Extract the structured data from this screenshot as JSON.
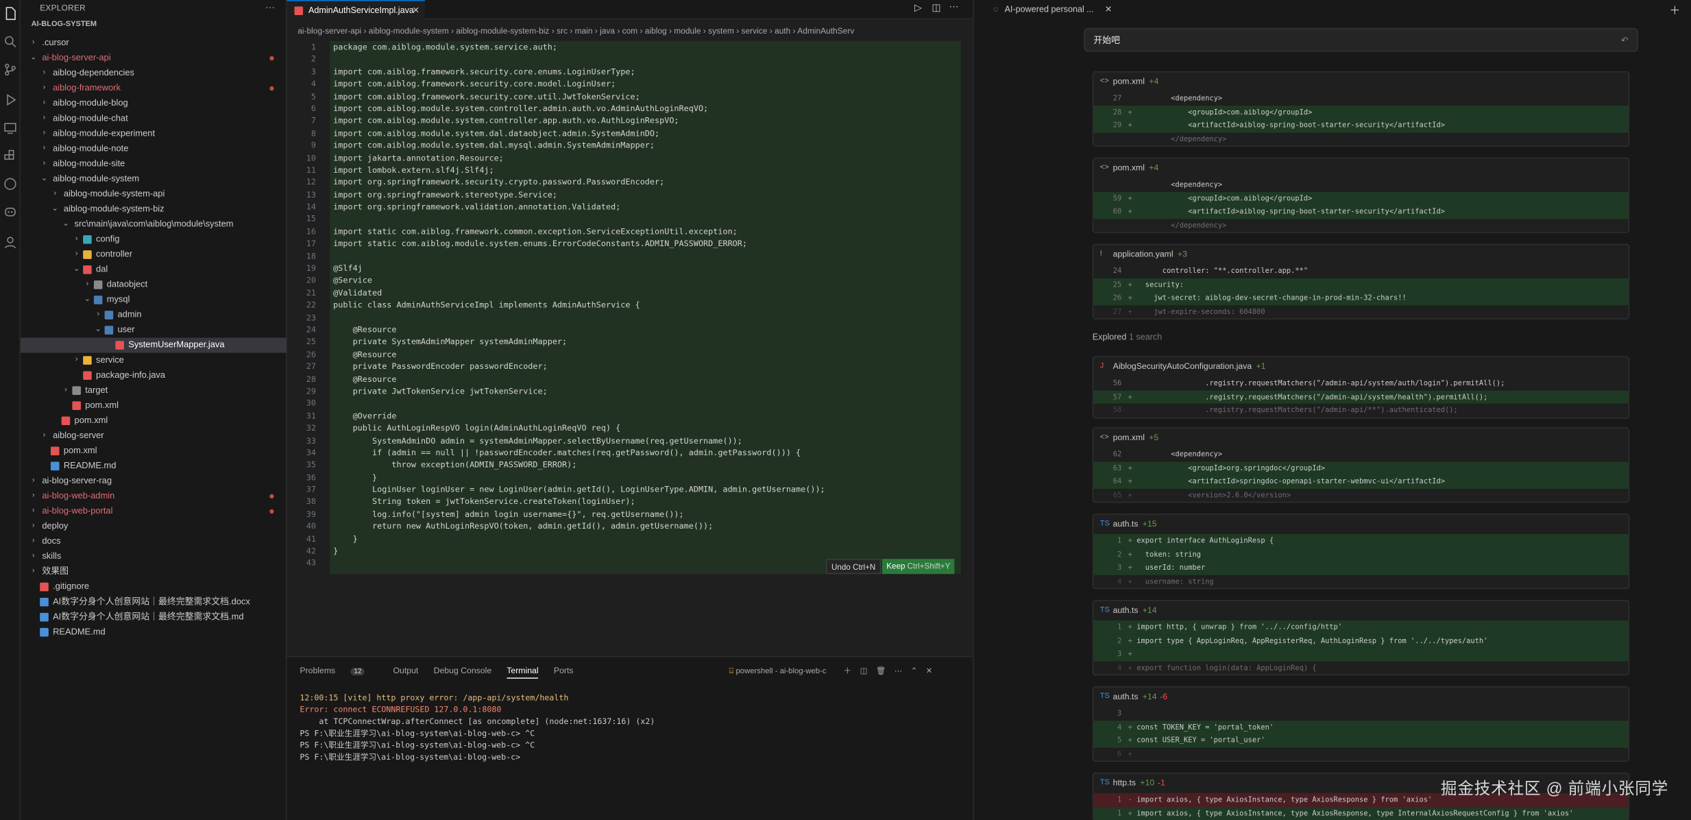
{
  "explorer": {
    "title": "EXPLORER",
    "root": "AI-BLOG-SYSTEM",
    "items": [
      {
        "label": ".cursor",
        "depth": 1,
        "type": "folder",
        "open": false,
        "color": "#ccc"
      },
      {
        "label": "ai-blog-server-api",
        "depth": 1,
        "type": "folder",
        "open": true,
        "color": "#e06c75",
        "dot": true
      },
      {
        "label": "aiblog-dependencies",
        "depth": 2,
        "type": "folder",
        "open": false,
        "color": "#ccc"
      },
      {
        "label": "aiblog-framework",
        "depth": 2,
        "type": "folder",
        "open": false,
        "color": "#e06c75",
        "dot": true
      },
      {
        "label": "aiblog-module-blog",
        "depth": 2,
        "type": "folder",
        "open": false,
        "color": "#ccc"
      },
      {
        "label": "aiblog-module-chat",
        "depth": 2,
        "type": "folder",
        "open": false,
        "color": "#ccc"
      },
      {
        "label": "aiblog-module-experiment",
        "depth": 2,
        "type": "folder",
        "open": false,
        "color": "#ccc"
      },
      {
        "label": "aiblog-module-note",
        "depth": 2,
        "type": "folder",
        "open": false,
        "color": "#ccc"
      },
      {
        "label": "aiblog-module-site",
        "depth": 2,
        "type": "folder",
        "open": false,
        "color": "#ccc"
      },
      {
        "label": "aiblog-module-system",
        "depth": 2,
        "type": "folder",
        "open": true,
        "color": "#ccc"
      },
      {
        "label": "aiblog-module-system-api",
        "depth": 3,
        "type": "folder",
        "open": false,
        "color": "#ccc"
      },
      {
        "label": "aiblog-module-system-biz",
        "depth": 3,
        "type": "folder",
        "open": true,
        "color": "#ccc"
      },
      {
        "label": "src\\main\\java\\com\\aiblog\\module\\system",
        "depth": 4,
        "type": "folder",
        "open": true,
        "color": "#ccc"
      },
      {
        "label": "config",
        "depth": 5,
        "type": "folder",
        "open": false,
        "color": "#ccc",
        "ficon": "#3aa6b9"
      },
      {
        "label": "controller",
        "depth": 5,
        "type": "folder",
        "open": false,
        "color": "#ccc",
        "ficon": "#e8b339"
      },
      {
        "label": "dal",
        "depth": 5,
        "type": "folder",
        "open": true,
        "color": "#ccc",
        "ficon": "#e55353"
      },
      {
        "label": "dataobject",
        "depth": 6,
        "type": "folder",
        "open": false,
        "color": "#ccc",
        "ficon": "#8a8a8a"
      },
      {
        "label": "mysql",
        "depth": 6,
        "type": "folder",
        "open": true,
        "color": "#ccc",
        "ficon": "#4a7fb5"
      },
      {
        "label": "admin",
        "depth": 7,
        "type": "folder",
        "open": false,
        "color": "#ccc",
        "ficon": "#4a7fb5"
      },
      {
        "label": "user",
        "depth": 7,
        "type": "folder",
        "open": true,
        "color": "#ccc",
        "ficon": "#4a7fb5"
      },
      {
        "label": "SystemUserMapper.java",
        "depth": 8,
        "type": "file",
        "color": "#fff",
        "ficon": "#e55353",
        "selected": true
      },
      {
        "label": "service",
        "depth": 5,
        "type": "folder",
        "open": false,
        "color": "#ccc",
        "ficon": "#e8b339"
      },
      {
        "label": "package-info.java",
        "depth": 5,
        "type": "file",
        "color": "#ccc",
        "ficon": "#e55353"
      },
      {
        "label": "target",
        "depth": 4,
        "type": "folder",
        "open": false,
        "color": "#ccc",
        "ficon": "#8a8a8a"
      },
      {
        "label": "pom.xml",
        "depth": 4,
        "type": "file",
        "color": "#ccc",
        "ficon": "#e55353"
      },
      {
        "label": "pom.xml",
        "depth": 3,
        "type": "file",
        "color": "#ccc",
        "ficon": "#e55353"
      },
      {
        "label": "aiblog-server",
        "depth": 2,
        "type": "folder",
        "open": false,
        "color": "#ccc"
      },
      {
        "label": "pom.xml",
        "depth": 2,
        "type": "file",
        "color": "#ccc",
        "ficon": "#e55353"
      },
      {
        "label": "README.md",
        "depth": 2,
        "type": "file",
        "color": "#ccc",
        "ficon": "#4a90d9"
      },
      {
        "label": "ai-blog-server-rag",
        "depth": 1,
        "type": "folder",
        "open": false,
        "color": "#ccc"
      },
      {
        "label": "ai-blog-web-admin",
        "depth": 1,
        "type": "folder",
        "open": false,
        "color": "#e06c75",
        "dot": true
      },
      {
        "label": "ai-blog-web-portal",
        "depth": 1,
        "type": "folder",
        "open": false,
        "color": "#e06c75",
        "dot": true
      },
      {
        "label": "deploy",
        "depth": 1,
        "type": "folder",
        "open": false,
        "color": "#ccc"
      },
      {
        "label": "docs",
        "depth": 1,
        "type": "folder",
        "open": false,
        "color": "#ccc"
      },
      {
        "label": "skills",
        "depth": 1,
        "type": "folder",
        "open": false,
        "color": "#ccc"
      },
      {
        "label": "效果图",
        "depth": 1,
        "type": "folder",
        "open": false,
        "color": "#ccc"
      },
      {
        "label": ".gitignore",
        "depth": 1,
        "type": "file",
        "color": "#ccc",
        "ficon": "#e55353"
      },
      {
        "label": "AI数字分身个人创意网站｜最终完整需求文档.docx",
        "depth": 1,
        "type": "file",
        "color": "#ccc",
        "ficon": "#4a90d9"
      },
      {
        "label": "AI数字分身个人创意网站｜最终完整需求文档.md",
        "depth": 1,
        "type": "file",
        "color": "#ccc",
        "ficon": "#4a90d9"
      },
      {
        "label": "README.md",
        "depth": 1,
        "type": "file",
        "color": "#ccc",
        "ficon": "#4a90d9"
      }
    ]
  },
  "editor": {
    "tab": "AdminAuthServiceImpl.java",
    "breadcrumb": "ai-blog-server-api  ›  aiblog-module-system  ›  aiblog-module-system-biz  ›  src  ›  main  ›  java  ›  com  ›  aiblog  ›  module  ›  system  ›  service  ›  auth  ›  AdminAuthServ",
    "undo": "Undo Ctrl+N",
    "keep": "Keep",
    "keep_shortcut": "Ctrl+Shift+Y",
    "lines": [
      {
        "n": "1",
        "t": "package com.aiblog.module.system.service.auth;"
      },
      {
        "n": "2",
        "t": ""
      },
      {
        "n": "3",
        "t": "import com.aiblog.framework.security.core.enums.LoginUserType;"
      },
      {
        "n": "4",
        "t": "import com.aiblog.framework.security.core.model.LoginUser;"
      },
      {
        "n": "5",
        "t": "import com.aiblog.framework.security.core.util.JwtTokenService;"
      },
      {
        "n": "6",
        "t": "import com.aiblog.module.system.controller.admin.auth.vo.AdminAuthLoginReqVO;"
      },
      {
        "n": "7",
        "t": "import com.aiblog.module.system.controller.app.auth.vo.AuthLoginRespVO;"
      },
      {
        "n": "8",
        "t": "import com.aiblog.module.system.dal.dataobject.admin.SystemAdminDO;"
      },
      {
        "n": "9",
        "t": "import com.aiblog.module.system.dal.mysql.admin.SystemAdminMapper;"
      },
      {
        "n": "10",
        "t": "import jakarta.annotation.Resource;"
      },
      {
        "n": "11",
        "t": "import lombok.extern.slf4j.Slf4j;"
      },
      {
        "n": "12",
        "t": "import org.springframework.security.crypto.password.PasswordEncoder;"
      },
      {
        "n": "13",
        "t": "import org.springframework.stereotype.Service;"
      },
      {
        "n": "14",
        "t": "import org.springframework.validation.annotation.Validated;"
      },
      {
        "n": "15",
        "t": ""
      },
      {
        "n": "16",
        "t": "import static com.aiblog.framework.common.exception.ServiceExceptionUtil.exception;"
      },
      {
        "n": "17",
        "t": "import static com.aiblog.module.system.enums.ErrorCodeConstants.ADMIN_PASSWORD_ERROR;"
      },
      {
        "n": "18",
        "t": ""
      },
      {
        "n": "19",
        "t": "@Slf4j"
      },
      {
        "n": "20",
        "t": "@Service"
      },
      {
        "n": "21",
        "t": "@Validated"
      },
      {
        "n": "22",
        "t": "public class AdminAuthServiceImpl implements AdminAuthService {"
      },
      {
        "n": "23",
        "t": ""
      },
      {
        "n": "24",
        "t": "    @Resource"
      },
      {
        "n": "25",
        "t": "    private SystemAdminMapper systemAdminMapper;"
      },
      {
        "n": "26",
        "t": "    @Resource"
      },
      {
        "n": "27",
        "t": "    private PasswordEncoder passwordEncoder;"
      },
      {
        "n": "28",
        "t": "    @Resource"
      },
      {
        "n": "29",
        "t": "    private JwtTokenService jwtTokenService;"
      },
      {
        "n": "30",
        "t": ""
      },
      {
        "n": "31",
        "t": "    @Override"
      },
      {
        "n": "32",
        "t": "    public AuthLoginRespVO login(AdminAuthLoginReqVO req) {"
      },
      {
        "n": "33",
        "t": "        SystemAdminDO admin = systemAdminMapper.selectByUsername(req.getUsername());"
      },
      {
        "n": "34",
        "t": "        if (admin == null || !passwordEncoder.matches(req.getPassword(), admin.getPassword())) {"
      },
      {
        "n": "35",
        "t": "            throw exception(ADMIN_PASSWORD_ERROR);"
      },
      {
        "n": "36",
        "t": "        }"
      },
      {
        "n": "37",
        "t": "        LoginUser loginUser = new LoginUser(admin.getId(), LoginUserType.ADMIN, admin.getUsername());"
      },
      {
        "n": "38",
        "t": "        String token = jwtTokenService.createToken(loginUser);"
      },
      {
        "n": "39",
        "t": "        log.info(\"[system] admin login username={}\", req.getUsername());"
      },
      {
        "n": "40",
        "t": "        return new AuthLoginRespVO(token, admin.getId(), admin.getUsername());"
      },
      {
        "n": "41",
        "t": "    }"
      },
      {
        "n": "42",
        "t": "}"
      },
      {
        "n": "43",
        "t": ""
      }
    ]
  },
  "panel": {
    "tabs": [
      "Problems",
      "Output",
      "Debug Console",
      "Terminal",
      "Ports"
    ],
    "problems_count": "12",
    "active_tab": "Terminal",
    "terminal_name": "powershell - ai-blog-web-c",
    "terminal_lines": [
      "12:00:15 [vite] http proxy error: /app-api/system/health",
      "Error: connect ECONNREFUSED 127.0.0.1:8080",
      "    at TCPConnectWrap.afterConnect [as oncomplete] (node:net:1637:16) (x2)",
      "PS F:\\职业生涯学习\\ai-blog-system\\ai-blog-web-c> ^C",
      "PS F:\\职业生涯学习\\ai-blog-system\\ai-blog-web-c> ^C",
      "PS F:\\职业生涯学习\\ai-blog-system\\ai-blog-web-c> "
    ]
  },
  "chat": {
    "title": "AI-powered personal ...",
    "input_value": "开始吧",
    "explored": "Explored",
    "explored_meta": "1 search",
    "watermark": "掘金技术社区 @ 前端小张同学",
    "cards": [
      {
        "icon": "<>",
        "file": "pom.xml",
        "added": "+4",
        "removed": "",
        "lines": [
          {
            "n": "27",
            "s": "",
            "c": "        <dependency>",
            "k": "ctx"
          },
          {
            "n": "28",
            "s": "+",
            "c": "            <groupId>com.aiblog</groupId>",
            "k": "add"
          },
          {
            "n": "29",
            "s": "+",
            "c": "            <artifactId>aiblog-spring-boot-starter-security</artifactId>",
            "k": "add"
          },
          {
            "n": "",
            "s": "",
            "c": "        </dependency>",
            "k": "fade"
          }
        ]
      },
      {
        "icon": "<>",
        "file": "pom.xml",
        "added": "+4",
        "removed": "",
        "lines": [
          {
            "n": "",
            "s": "",
            "c": "        <dependency>",
            "k": "ctx"
          },
          {
            "n": "59",
            "s": "+",
            "c": "            <groupId>com.aiblog</groupId>",
            "k": "add"
          },
          {
            "n": "60",
            "s": "+",
            "c": "            <artifactId>aiblog-spring-boot-starter-security</artifactId>",
            "k": "add"
          },
          {
            "n": "",
            "s": "",
            "c": "        </dependency>",
            "k": "fade"
          }
        ]
      },
      {
        "icon": "!",
        "file": "application.yaml",
        "added": "+3",
        "removed": "",
        "lines": [
          {
            "n": "24",
            "s": "",
            "c": "      controller: \"**.controller.app.**\"",
            "k": "ctx"
          },
          {
            "n": "25",
            "s": "+",
            "c": "  security:",
            "k": "add"
          },
          {
            "n": "26",
            "s": "+",
            "c": "    jwt-secret: aiblog-dev-secret-change-in-prod-min-32-chars!!",
            "k": "add"
          },
          {
            "n": "27",
            "s": "+",
            "c": "    jwt-expire-seconds: 604800",
            "k": "fade"
          }
        ]
      },
      {
        "icon": "J",
        "file": "AiblogSecurityAutoConfiguration.java",
        "added": "+1",
        "removed": "",
        "lines": [
          {
            "n": "56",
            "s": "",
            "c": "                .registry.requestMatchers(\"/admin-api/system/auth/login\").permitAll();",
            "k": "ctx"
          },
          {
            "n": "57",
            "s": "+",
            "c": "                .registry.requestMatchers(\"/admin-api/system/health\").permitAll();",
            "k": "add"
          },
          {
            "n": "58",
            "s": "",
            "c": "                .registry.requestMatchers(\"/admin-api/**\").authenticated();",
            "k": "fade"
          }
        ]
      },
      {
        "icon": "<>",
        "file": "pom.xml",
        "added": "+5",
        "removed": "",
        "lines": [
          {
            "n": "62",
            "s": "",
            "c": "        <dependency>",
            "k": "ctx"
          },
          {
            "n": "63",
            "s": "+",
            "c": "            <groupId>org.springdoc</groupId>",
            "k": "add"
          },
          {
            "n": "64",
            "s": "+",
            "c": "            <artifactId>springdoc-openapi-starter-webmvc-ui</artifactId>",
            "k": "add"
          },
          {
            "n": "65",
            "s": "+",
            "c": "            <version>2.6.0</version>",
            "k": "fade"
          }
        ]
      },
      {
        "icon": "TS",
        "file": "auth.ts",
        "added": "+15",
        "removed": "",
        "lines": [
          {
            "n": "1",
            "s": "+",
            "c": "export interface AuthLoginResp {",
            "k": "add"
          },
          {
            "n": "2",
            "s": "+",
            "c": "  token: string",
            "k": "add"
          },
          {
            "n": "3",
            "s": "+",
            "c": "  userId: number",
            "k": "add"
          },
          {
            "n": "4",
            "s": "+",
            "c": "  username: string",
            "k": "fade"
          }
        ]
      },
      {
        "icon": "TS",
        "file": "auth.ts",
        "added": "+14",
        "removed": "",
        "lines": [
          {
            "n": "1",
            "s": "+",
            "c": "import http, { unwrap } from '../../config/http'",
            "k": "add"
          },
          {
            "n": "2",
            "s": "+",
            "c": "import type { AppLoginReq, AppRegisterReq, AuthLoginResp } from '../../types/auth'",
            "k": "add"
          },
          {
            "n": "3",
            "s": "+",
            "c": "",
            "k": "add"
          },
          {
            "n": "4",
            "s": "+",
            "c": "export function login(data: AppLoginReq) {",
            "k": "fade"
          }
        ]
      },
      {
        "icon": "TS",
        "file": "auth.ts",
        "added": "+14",
        "removed": "-6",
        "lines": [
          {
            "n": "3",
            "s": "",
            "c": "",
            "k": "ctx"
          },
          {
            "n": "4",
            "s": "+",
            "c": "const TOKEN_KEY = 'portal_token'",
            "k": "add"
          },
          {
            "n": "5",
            "s": "+",
            "c": "const USER_KEY = 'portal_user'",
            "k": "add"
          },
          {
            "n": "6",
            "s": "+",
            "c": "",
            "k": "fade"
          }
        ]
      },
      {
        "icon": "TS",
        "file": "http.ts",
        "added": "+10",
        "removed": "-1",
        "lines": [
          {
            "n": "1",
            "s": "-",
            "c": "import axios, { type AxiosInstance, type AxiosResponse } from 'axios'",
            "k": "rem"
          },
          {
            "n": "1",
            "s": "+",
            "c": "import axios, { type AxiosInstance, type AxiosResponse, type InternalAxiosRequestConfig } from 'axios'",
            "k": "add"
          }
        ]
      }
    ]
  }
}
